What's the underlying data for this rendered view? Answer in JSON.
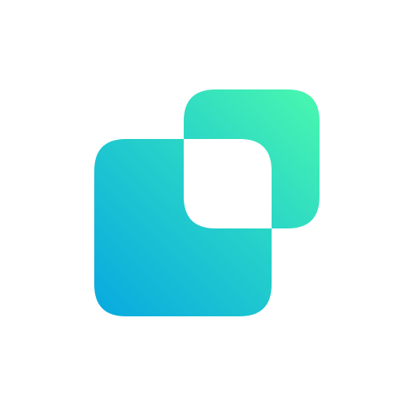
{
  "icon": {
    "name": "overlapping-squares-logo-icon",
    "colors": {
      "gradient_start": "#07A9E0",
      "gradient_mid": "#24CFCB",
      "gradient_end": "#4AF8AE",
      "background": "#FFFFFF"
    }
  }
}
